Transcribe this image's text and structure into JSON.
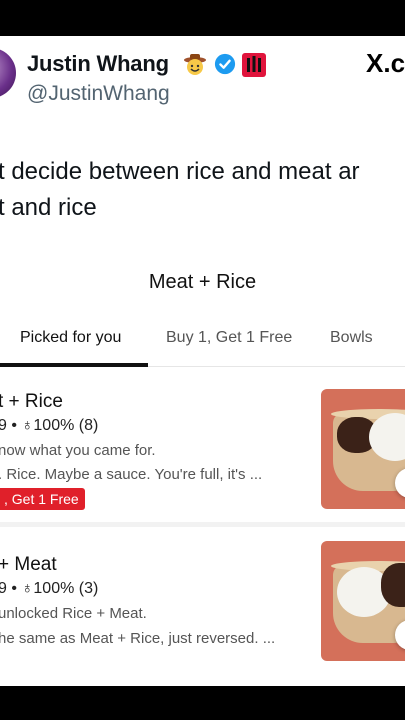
{
  "tweet": {
    "name": "Justin Whang",
    "handle": "@JustinWhang",
    "platform_logo": "X.c",
    "text_lines": [
      "t decide between rice and meat ar",
      "t and rice"
    ]
  },
  "store": {
    "title": "Meat + Rice",
    "tabs": [
      {
        "label": "Picked for you",
        "active": true
      },
      {
        "label": "Buy 1, Get 1 Free",
        "active": false
      },
      {
        "label": "Bowls",
        "active": false
      }
    ],
    "items": [
      {
        "title": "t + Rice",
        "meta": "9 • ♁100% (8)",
        "desc": [
          "now what you came for.",
          ". Rice. Maybe a sauce. You're full, it's ..."
        ],
        "promo": ", Get 1 Free"
      },
      {
        "title": "+ Meat",
        "meta": "9 • ♁100% (3)",
        "desc": [
          "unlocked Rice + Meat.",
          "he same as Meat + Rice, just reversed. ..."
        ],
        "promo": ""
      }
    ]
  },
  "colors": {
    "verified": "#1d9bf0",
    "promo_bg": "#e0202a",
    "photo_bg": "#d4705a"
  }
}
